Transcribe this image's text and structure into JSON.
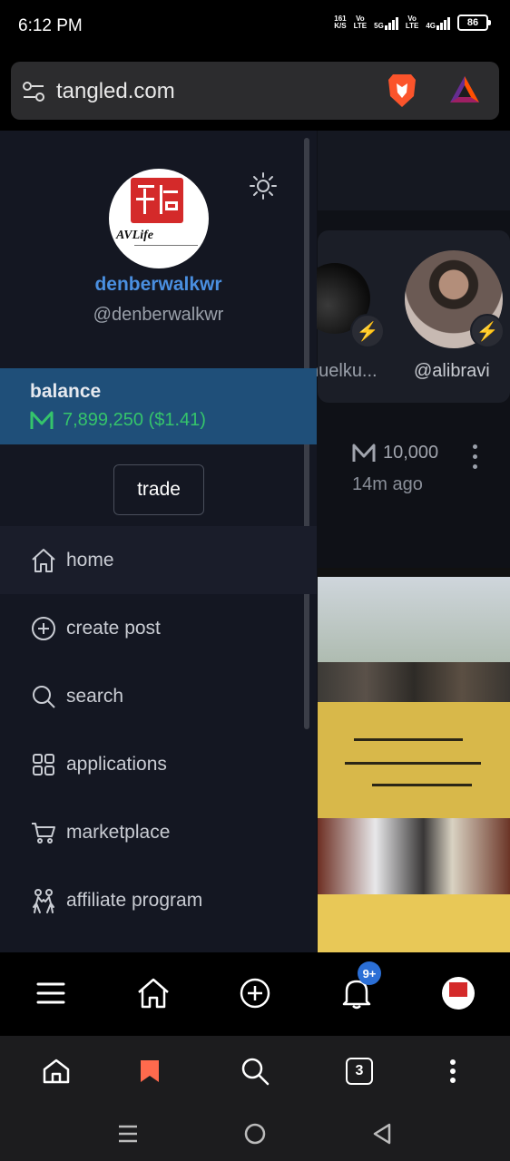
{
  "status_bar": {
    "time": "6:12 PM",
    "speed_value": "161",
    "speed_unit": "K/S",
    "volte1_top": "Vo",
    "volte1_bottom": "LTE",
    "net1": "5G",
    "volte2_top": "Vo",
    "volte2_bottom": "LTE",
    "net2": "4G",
    "battery": "86"
  },
  "browser": {
    "url": "tangled.com",
    "tab_count": "3",
    "icons": [
      "tune-icon",
      "brave-lion-icon",
      "brave-rewards-icon"
    ]
  },
  "drawer": {
    "display_name": "denberwalkwr",
    "handle": "@denberwalkwr",
    "avatar_logo_text": "AVLife",
    "balance_label": "balance",
    "balance_value": "7,899,250 ($1.41)",
    "trade_label": "trade",
    "menu": [
      {
        "label": "home",
        "icon": "home-icon",
        "active": true
      },
      {
        "label": "create post",
        "icon": "plus-circle-icon"
      },
      {
        "label": "search",
        "icon": "search-icon"
      },
      {
        "label": "applications",
        "icon": "grid-icon"
      },
      {
        "label": "marketplace",
        "icon": "cart-icon"
      },
      {
        "label": "affiliate program",
        "icon": "people-icon"
      }
    ]
  },
  "background_feed": {
    "creator_1_name": "nuelku...",
    "creator_2_name": "@alibravi",
    "post_amount": "10,000",
    "post_time": "14m ago"
  },
  "app_nav": {
    "notification_badge": "9+",
    "items": [
      "menu-icon",
      "home-icon",
      "plus-circle-icon",
      "bell-icon",
      "avatar"
    ]
  },
  "colors": {
    "accent_blue": "#4a8fe0",
    "balance_green": "#35c46b",
    "balance_bg": "#1f4f79",
    "drawer_bg": "#141722",
    "bookmark_orange": "#ff6a4d"
  }
}
